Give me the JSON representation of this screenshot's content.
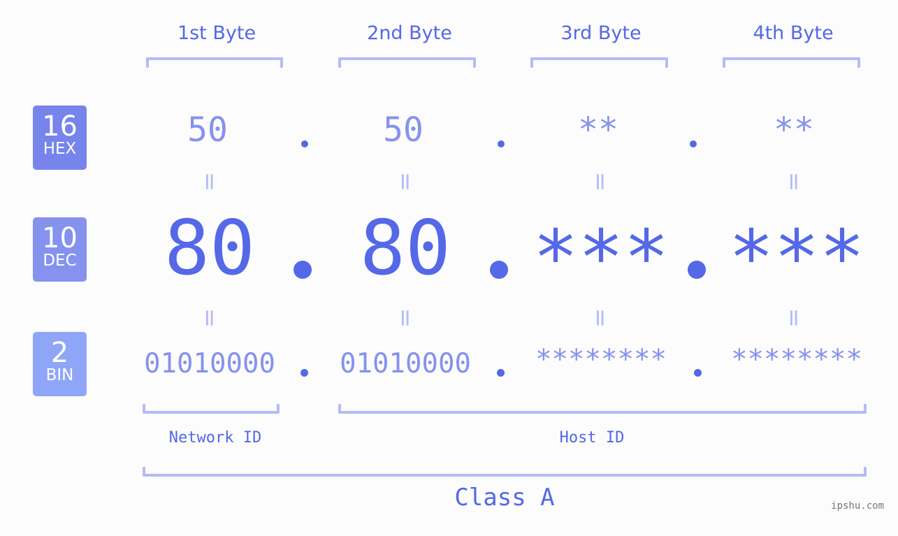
{
  "bytes": {
    "headers": [
      "1st Byte",
      "2nd Byte",
      "3rd Byte",
      "4th Byte"
    ]
  },
  "bases": {
    "hex": {
      "number": "16",
      "label": "HEX",
      "color": "#7684ec"
    },
    "dec": {
      "number": "10",
      "label": "DEC",
      "color": "#8592ee"
    },
    "bin": {
      "number": "2",
      "label": "BIN",
      "color": "#8fa6f8"
    }
  },
  "values": {
    "hex": [
      "50",
      "50",
      "**",
      "**"
    ],
    "dec": [
      "80",
      "80",
      "***",
      "***"
    ],
    "bin": [
      "01010000",
      "01010000",
      "********",
      "********"
    ]
  },
  "separator": ".",
  "equals": "=",
  "segments": {
    "network": "Network ID",
    "host": "Host ID",
    "class": "Class A"
  },
  "colors": {
    "accent": "#5468e8",
    "light": "#8592ee",
    "bracket": "#b3bcf6"
  },
  "watermark": "ipshu.com"
}
